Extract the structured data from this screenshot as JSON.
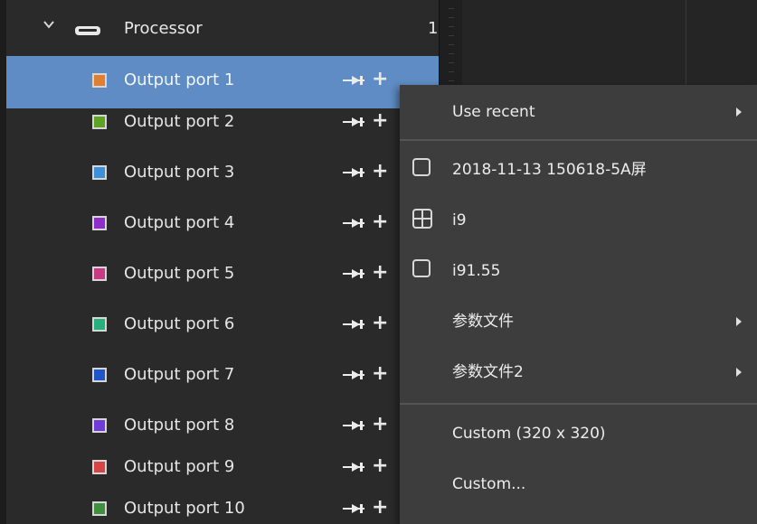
{
  "tree": {
    "group": {
      "title": "Processor",
      "count": "1",
      "expander_icon": "chevron-down-icon",
      "group_icon": "processor-icon"
    },
    "ports": [
      {
        "label": "Output port 1",
        "color": "#e07f30",
        "selected": true
      },
      {
        "label": "Output port 2",
        "color": "#5fa323"
      },
      {
        "label": "Output port 3",
        "color": "#3d8fd8"
      },
      {
        "label": "Output port 4",
        "color": "#8d2fc8"
      },
      {
        "label": "Output port 5",
        "color": "#c83a84"
      },
      {
        "label": "Output port 6",
        "color": "#26b07d"
      },
      {
        "label": "Output port 7",
        "color": "#1f55c9"
      },
      {
        "label": "Output port 8",
        "color": "#6f3cd9"
      },
      {
        "label": "Output port 9",
        "color": "#d64545"
      },
      {
        "label": "Output port 10",
        "color": "#3f8f3f"
      }
    ],
    "row_icons": [
      "pin-icon",
      "plus-icon"
    ],
    "selection_color": "#5f8cc4"
  },
  "context_menu": {
    "items": [
      {
        "label": "Use recent",
        "submenu": true
      },
      {
        "label": "2018-11-13 150618-5A屏",
        "icon": "checkbox"
      },
      {
        "label": "i9",
        "icon": "grid-layout"
      },
      {
        "label": "i91.55",
        "icon": "checkbox"
      },
      {
        "label": "参数文件",
        "submenu": true
      },
      {
        "label": "参数文件2",
        "submenu": true
      },
      {
        "label": "Custom (320 x 320)"
      },
      {
        "label": "Custom..."
      }
    ]
  }
}
